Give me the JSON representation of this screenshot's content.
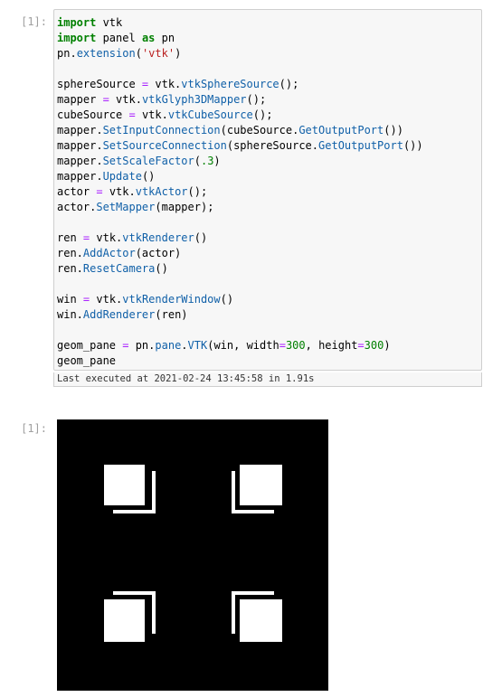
{
  "input_cell": {
    "prompt": "[1]:",
    "lines": [
      [
        {
          "t": "import",
          "c": "kw"
        },
        {
          "t": " vtk",
          "c": "txt"
        }
      ],
      [
        {
          "t": "import",
          "c": "kw"
        },
        {
          "t": " panel ",
          "c": "txt"
        },
        {
          "t": "as",
          "c": "kw"
        },
        {
          "t": " pn",
          "c": "txt"
        }
      ],
      [
        {
          "t": "pn.",
          "c": "txt"
        },
        {
          "t": "extension",
          "c": "attr"
        },
        {
          "t": "(",
          "c": "txt"
        },
        {
          "t": "'vtk'",
          "c": "str"
        },
        {
          "t": ")",
          "c": "txt"
        }
      ],
      [],
      [
        {
          "t": "sphereSource ",
          "c": "txt"
        },
        {
          "t": "=",
          "c": "op"
        },
        {
          "t": " vtk.",
          "c": "txt"
        },
        {
          "t": "vtkSphereSource",
          "c": "attr"
        },
        {
          "t": "();",
          "c": "txt"
        }
      ],
      [
        {
          "t": "mapper ",
          "c": "txt"
        },
        {
          "t": "=",
          "c": "op"
        },
        {
          "t": " vtk.",
          "c": "txt"
        },
        {
          "t": "vtkGlyph3DMapper",
          "c": "attr"
        },
        {
          "t": "();",
          "c": "txt"
        }
      ],
      [
        {
          "t": "cubeSource ",
          "c": "txt"
        },
        {
          "t": "=",
          "c": "op"
        },
        {
          "t": " vtk.",
          "c": "txt"
        },
        {
          "t": "vtkCubeSource",
          "c": "attr"
        },
        {
          "t": "();",
          "c": "txt"
        }
      ],
      [
        {
          "t": "mapper.",
          "c": "txt"
        },
        {
          "t": "SetInputConnection",
          "c": "attr"
        },
        {
          "t": "(cubeSource.",
          "c": "txt"
        },
        {
          "t": "GetOutputPort",
          "c": "attr"
        },
        {
          "t": "())",
          "c": "txt"
        }
      ],
      [
        {
          "t": "mapper.",
          "c": "txt"
        },
        {
          "t": "SetSourceConnection",
          "c": "attr"
        },
        {
          "t": "(sphereSource.",
          "c": "txt"
        },
        {
          "t": "GetOutputPort",
          "c": "attr"
        },
        {
          "t": "())",
          "c": "txt"
        }
      ],
      [
        {
          "t": "mapper.",
          "c": "txt"
        },
        {
          "t": "SetScaleFactor",
          "c": "attr"
        },
        {
          "t": "(",
          "c": "txt"
        },
        {
          "t": ".3",
          "c": "num"
        },
        {
          "t": ")",
          "c": "txt"
        }
      ],
      [
        {
          "t": "mapper.",
          "c": "txt"
        },
        {
          "t": "Update",
          "c": "attr"
        },
        {
          "t": "()",
          "c": "txt"
        }
      ],
      [
        {
          "t": "actor ",
          "c": "txt"
        },
        {
          "t": "=",
          "c": "op"
        },
        {
          "t": " vtk.",
          "c": "txt"
        },
        {
          "t": "vtkActor",
          "c": "attr"
        },
        {
          "t": "();",
          "c": "txt"
        }
      ],
      [
        {
          "t": "actor.",
          "c": "txt"
        },
        {
          "t": "SetMapper",
          "c": "attr"
        },
        {
          "t": "(mapper);",
          "c": "txt"
        }
      ],
      [],
      [
        {
          "t": "ren ",
          "c": "txt"
        },
        {
          "t": "=",
          "c": "op"
        },
        {
          "t": " vtk.",
          "c": "txt"
        },
        {
          "t": "vtkRenderer",
          "c": "attr"
        },
        {
          "t": "()",
          "c": "txt"
        }
      ],
      [
        {
          "t": "ren.",
          "c": "txt"
        },
        {
          "t": "AddActor",
          "c": "attr"
        },
        {
          "t": "(actor)",
          "c": "txt"
        }
      ],
      [
        {
          "t": "ren.",
          "c": "txt"
        },
        {
          "t": "ResetCamera",
          "c": "attr"
        },
        {
          "t": "()",
          "c": "txt"
        }
      ],
      [],
      [
        {
          "t": "win ",
          "c": "txt"
        },
        {
          "t": "=",
          "c": "op"
        },
        {
          "t": " vtk.",
          "c": "txt"
        },
        {
          "t": "vtkRenderWindow",
          "c": "attr"
        },
        {
          "t": "()",
          "c": "txt"
        }
      ],
      [
        {
          "t": "win.",
          "c": "txt"
        },
        {
          "t": "AddRenderer",
          "c": "attr"
        },
        {
          "t": "(ren)",
          "c": "txt"
        }
      ],
      [],
      [
        {
          "t": "geom_pane ",
          "c": "txt"
        },
        {
          "t": "=",
          "c": "op"
        },
        {
          "t": " pn.",
          "c": "txt"
        },
        {
          "t": "pane",
          "c": "attr"
        },
        {
          "t": ".",
          "c": "txt"
        },
        {
          "t": "VTK",
          "c": "attr"
        },
        {
          "t": "(win, width",
          "c": "txt"
        },
        {
          "t": "=",
          "c": "op"
        },
        {
          "t": "300",
          "c": "num"
        },
        {
          "t": ", height",
          "c": "txt"
        },
        {
          "t": "=",
          "c": "op"
        },
        {
          "t": "300",
          "c": "num"
        },
        {
          "t": ")",
          "c": "txt"
        }
      ],
      [
        {
          "t": "geom_pane",
          "c": "txt"
        }
      ]
    ],
    "status": "Last executed at 2021-02-24 13:45:58 in 1.91s"
  },
  "output_cell": {
    "prompt": "[1]:",
    "render": {
      "background": "#000000",
      "glyph_color": "#ffffff",
      "glyph_count": 4
    }
  },
  "colors": {
    "keyword": "#008000",
    "attribute": "#1060a8",
    "string": "#ba2121",
    "number": "#008000",
    "operator": "#aa22ff",
    "prompt": "#a0a0a0",
    "cell_background": "#f7f7f7",
    "cell_border": "#cfcfcf"
  }
}
